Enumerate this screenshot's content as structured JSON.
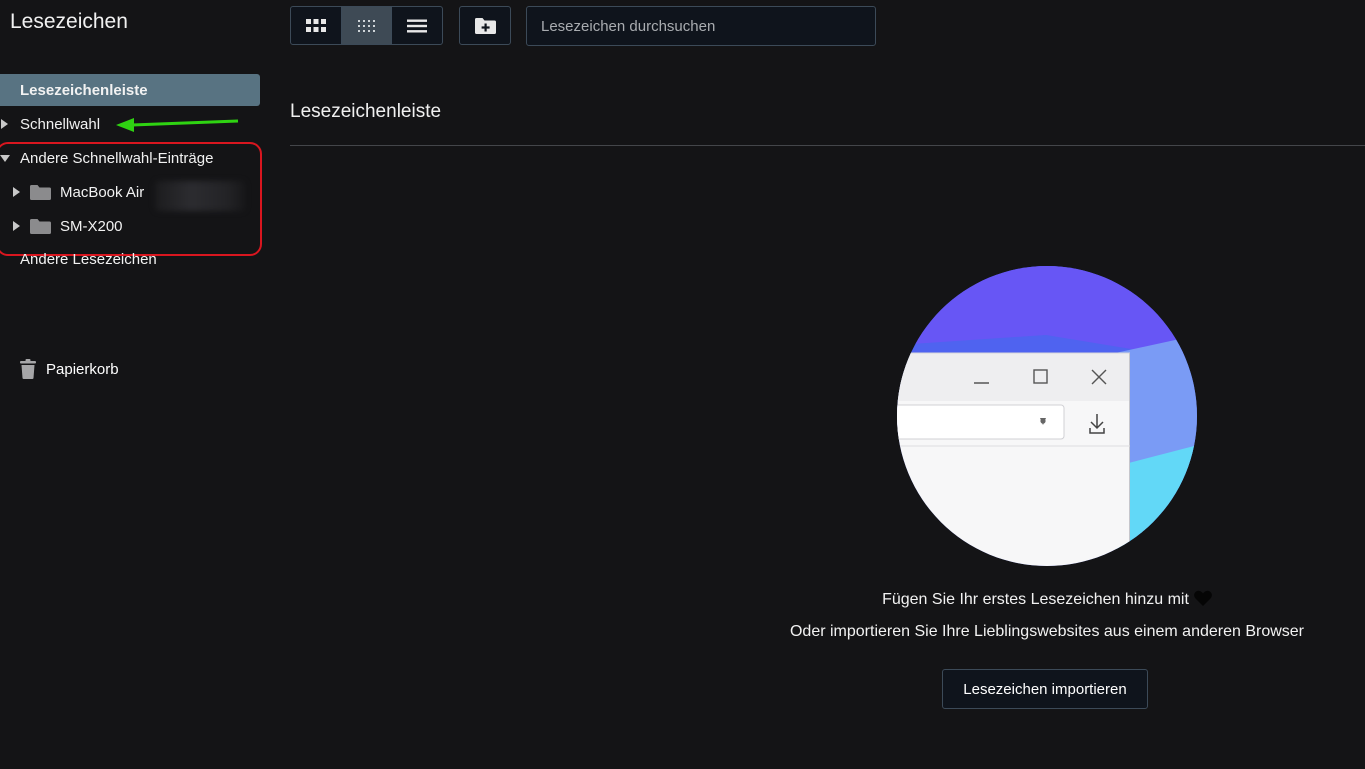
{
  "app": {
    "title": "Lesezeichen"
  },
  "sidebar": {
    "items": [
      {
        "label": "Lesezeichenleiste"
      },
      {
        "label": "Schnellwahl"
      },
      {
        "label": "Andere Schnellwahl-Einträge"
      },
      {
        "label": "MacBook Air"
      },
      {
        "label": "SM-X200"
      },
      {
        "label": "Andere Lesezeichen"
      }
    ],
    "trash_label": "Papierkorb"
  },
  "toolbar": {
    "view_modes": [
      "large-grid",
      "small-grid",
      "list"
    ],
    "active_view": "small-grid",
    "search_placeholder": "Lesezeichen durchsuchen"
  },
  "main": {
    "section_title": "Lesezeichenleiste",
    "empty_text_1": "Fügen Sie Ihr erstes Lesezeichen hinzu mit",
    "empty_text_2": "Oder importieren Sie Ihre Lieblingswebsites aus einem anderen Browser",
    "import_button": "Lesezeichen importieren"
  },
  "colors": {
    "background": "#141416",
    "selected_item": "#587382",
    "annotation_box": "#d9161f",
    "annotation_arrow": "#2fd312"
  }
}
